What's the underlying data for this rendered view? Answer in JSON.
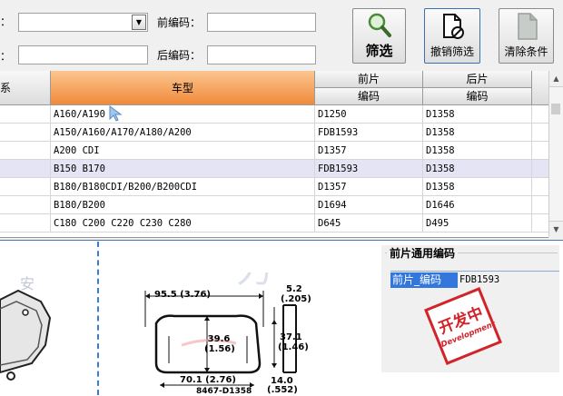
{
  "filter": {
    "row1_label_left": "：",
    "row2_label_left": "：",
    "front_code_label": "前编码：",
    "rear_code_label": "后编码：",
    "combo_value": "",
    "front_code_value": "",
    "rear_code_value": "",
    "field_left2_value": ""
  },
  "toolbar": {
    "filter_label": "筛选",
    "cancel_filter_label": "撤销筛选",
    "clear_label": "清除条件"
  },
  "table": {
    "headers": {
      "col0": "系",
      "model": "车型",
      "front_top": "前片",
      "front_bottom": "编码",
      "rear_top": "后片",
      "rear_bottom": "编码"
    },
    "rows": [
      {
        "model": "A160/A190",
        "front": "D1250",
        "rear": "D1358"
      },
      {
        "model": "A150/A160/A170/A180/A200",
        "front": "FDB1593",
        "rear": "D1358"
      },
      {
        "model": "A200 CDI",
        "front": "D1357",
        "rear": "D1358"
      },
      {
        "model": "B150 B170",
        "front": "FDB1593",
        "rear": "D1358"
      },
      {
        "model": "B180/B180CDI/B200/B200CDI",
        "front": "D1357",
        "rear": "D1358"
      },
      {
        "model": "B180/B200",
        "front": "D1694",
        "rear": "D1646"
      },
      {
        "model": "C180 C200 C220 C230 C280",
        "front": "D645",
        "rear": "D495"
      }
    ]
  },
  "drawing": {
    "dim_width": "95.5 (3.76)",
    "dim_height_inner": "39.6",
    "dim_height_inner_in": "(1.56)",
    "dim_right": "37.1",
    "dim_right_in": "(1.46)",
    "dim_thk": "5.2",
    "dim_thk_in": "(.205)",
    "dim_bottom": "70.1 (2.76)",
    "dim_bottom_thk": "14.0",
    "dim_bottom_thk_in": "(.552)",
    "part_no": "8467-D1358"
  },
  "common_code": {
    "title": "前片通用编码",
    "key": "前片_编码",
    "value": "FDB1593",
    "stamp_cn": "开发中",
    "stamp_en": "Development"
  },
  "colors": {
    "selected_header": "#f08a3a",
    "highlight_row": "#e4e4f4",
    "selected_cell": "#3377dd",
    "stamp_red": "#d2232a",
    "dash_blue": "#3a7bd5"
  }
}
